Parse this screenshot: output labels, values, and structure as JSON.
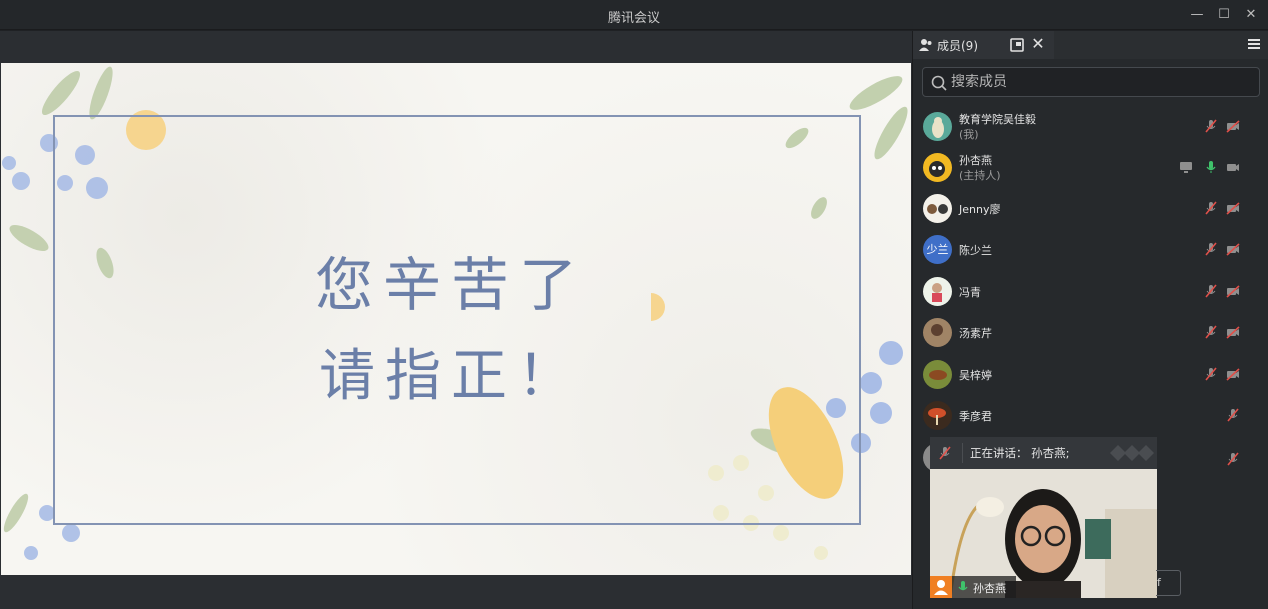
{
  "window": {
    "title": "腾讯会议",
    "min_glyph": "—",
    "max_glyph": "☐",
    "close_glyph": "✕"
  },
  "slide": {
    "line1": "您辛苦了",
    "line2": "请指正！"
  },
  "panel": {
    "members_tab_label": "成员(9)",
    "close_glyph": "✕",
    "search_placeholder": "搜索成员"
  },
  "members": [
    {
      "name": "教育学院吴佳毅",
      "role": "(我)",
      "mic": "muted",
      "camera": "off"
    },
    {
      "name": "孙杏燕",
      "role": "(主持人)",
      "mic": "on",
      "camera": "on",
      "screen_share": true
    },
    {
      "name": "Jenny廖",
      "role": "",
      "mic": "muted",
      "camera": "off"
    },
    {
      "name": "陈少兰",
      "role": "",
      "avatar_text": "少兰",
      "mic": "muted",
      "camera": "off"
    },
    {
      "name": "冯青",
      "role": "",
      "mic": "muted",
      "camera": "off"
    },
    {
      "name": "汤素芹",
      "role": "",
      "mic": "muted",
      "camera": "off"
    },
    {
      "name": "吴梓婷",
      "role": "",
      "mic": "muted",
      "camera": "off"
    },
    {
      "name": "季彦君",
      "role": "",
      "mic": "muted"
    },
    {
      "mic": "muted"
    }
  ],
  "speaking": {
    "text": "正在讲话：  孙杏燕;"
  },
  "video": {
    "speaker_name": "孙杏燕"
  },
  "bottom_button": {
    "label_fragment": "f"
  },
  "colors": {
    "accent_orange": "#f07f22",
    "mic_on_green": "#3fc26b",
    "muted_red": "#e0504a",
    "slide_text": "#6b7fa8"
  }
}
